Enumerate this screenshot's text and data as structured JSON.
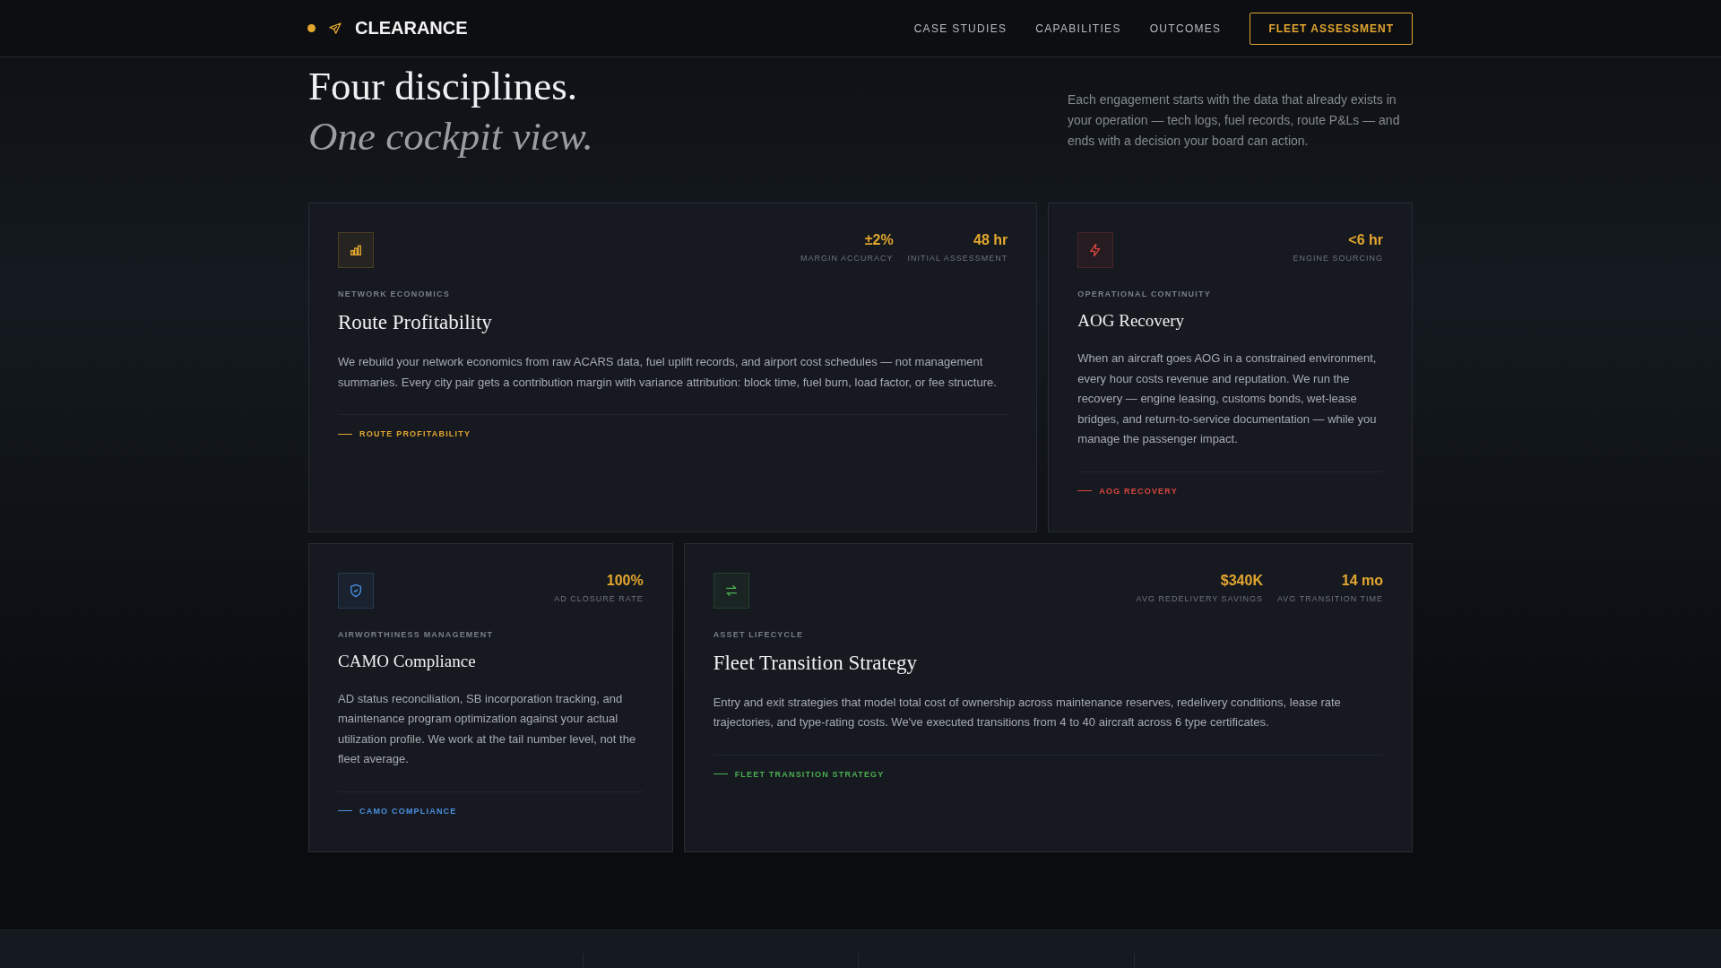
{
  "header": {
    "brand": "CLEARANCE",
    "nav": [
      {
        "label": "CASE STUDIES"
      },
      {
        "label": "CAPABILITIES"
      },
      {
        "label": "OUTCOMES"
      }
    ],
    "cta": "FLEET ASSESSMENT"
  },
  "hero": {
    "title": "Four disciplines.",
    "subtitle": "One cockpit view.",
    "intro": "Each engagement starts with the data that already exists in your operation — tech logs, fuel records, route P&Ls — and ends with a decision your board can action."
  },
  "cards": [
    {
      "eyebrow": "NETWORK ECONOMICS",
      "title": "Route Profitability",
      "body": "We rebuild your network economics from raw ACARS data, fuel uplift records, and airport cost schedules — not management summaries. Every city pair gets a contribution margin with variance attribution: block time, fuel burn, load factor, or fee structure.",
      "link": "ROUTE PROFITABILITY",
      "color": "#e3a62f",
      "stats": [
        {
          "value": "±2%",
          "label": "MARGIN ACCURACY"
        },
        {
          "value": "48 hr",
          "label": "INITIAL ASSESSMENT"
        }
      ]
    },
    {
      "eyebrow": "OPERATIONAL CONTINUITY",
      "title": "AOG Recovery",
      "body": "When an aircraft goes AOG in a constrained environment, every hour costs revenue and reputation. We run the recovery — engine leasing, customs bonds, wet-lease bridges, and return-to-service documentation — while you manage the passenger impact.",
      "link": "AOG RECOVERY",
      "color": "#d9453f",
      "stats": [
        {
          "value": "<6 hr",
          "label": "ENGINE SOURCING"
        }
      ]
    },
    {
      "eyebrow": "AIRWORTHINESS MANAGEMENT",
      "title": "CAMO Compliance",
      "body": "AD status reconciliation, SB incorporation tracking, and maintenance program optimization against your actual utilization profile. We work at the tail number level, not the fleet average.",
      "link": "CAMO COMPLIANCE",
      "color": "#4a90e2",
      "stats": [
        {
          "value": "100%",
          "label": "AD CLOSURE RATE"
        }
      ]
    },
    {
      "eyebrow": "ASSET LIFECYCLE",
      "title": "Fleet Transition Strategy",
      "body": "Entry and exit strategies that model total cost of ownership across maintenance reserves, redelivery conditions, lease rate trajectories, and type-rating costs. We've executed transitions from 4 to 40 aircraft across 6 type certificates.",
      "link": "FLEET TRANSITION STRATEGY",
      "color": "#4caf50",
      "stats": [
        {
          "value": "$340K",
          "label": "AVG REDELIVERY SAVINGS"
        },
        {
          "value": "14 mo",
          "label": "AVG TRANSITION TIME"
        }
      ]
    }
  ]
}
